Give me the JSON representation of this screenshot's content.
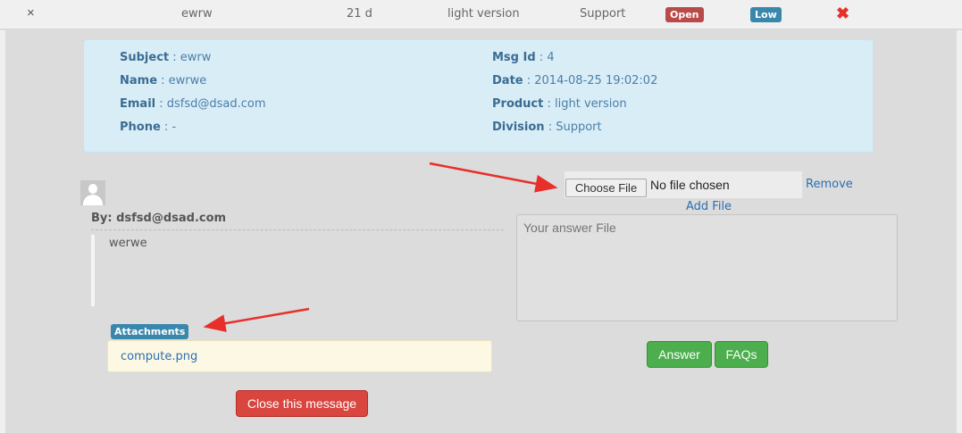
{
  "ticket_row": {
    "collapse_icon": "×",
    "subject": "ewrw",
    "age": "21 d",
    "product": "light version",
    "division": "Support",
    "status": "Open",
    "priority": "Low",
    "delete_icon": "✖"
  },
  "info": {
    "subject_label": "Subject",
    "subject_value": "ewrw",
    "name_label": "Name",
    "name_value": "ewrwe",
    "email_label": "Email",
    "email_value": "dsfsd@dsad.com",
    "phone_label": "Phone",
    "phone_value": "-",
    "msgid_label": "Msg Id",
    "msgid_value": "4",
    "date_label": "Date",
    "date_value": "2014-08-25 19:02:02",
    "product_label": "Product",
    "product_value": "light version",
    "division_label": "Division",
    "division_value": "Support"
  },
  "message": {
    "by": "By: dsfsd@dsad.com",
    "body": "werwe",
    "attachments_label": "Attachments",
    "attachment_file": "compute.png",
    "close_button": "Close this message"
  },
  "reply": {
    "choose_file": "Choose File",
    "no_file": "No file chosen",
    "remove": "Remove",
    "add_file": "Add File",
    "answer_placeholder": "Your answer File",
    "answer_button": "Answer",
    "faqs_button": "FAQs"
  },
  "colors": {
    "open_badge": "#b94a48",
    "low_badge": "#3a87ad",
    "annotation_arrow": "#e8302a"
  }
}
